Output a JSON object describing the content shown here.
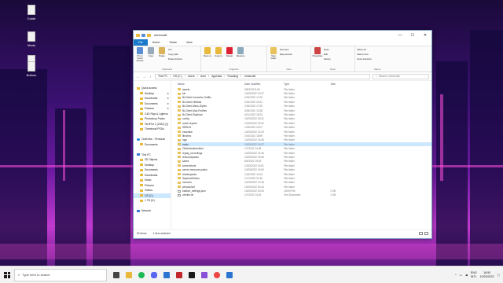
{
  "desktop": {
    "icons": [
      {
        "label": "Guide"
      },
      {
        "label": "Mods"
      },
      {
        "label": "Docs"
      },
      {
        "label": "Bottom"
      }
    ]
  },
  "window": {
    "title": "minecraft",
    "controls": {
      "minimize": "—",
      "maximize": "☐",
      "close": "✕"
    },
    "ribbon_tabs": [
      "File",
      "Home",
      "Share",
      "View"
    ],
    "ribbon": {
      "clipboard": {
        "label": "Clipboard",
        "pin": "Pin to Quick access",
        "copy": "Copy",
        "paste": "Paste",
        "cut": "Cut",
        "copy_path": "Copy path",
        "paste_shortcut": "Paste shortcut"
      },
      "organize": {
        "label": "Organize",
        "move_to": "Move to",
        "copy_to": "Copy to",
        "delete": "Delete",
        "rename": "Rename"
      },
      "new": {
        "label": "New",
        "new_folder": "New folder",
        "new_item": "New item",
        "easy_access": "Easy access"
      },
      "open": {
        "label": "Open",
        "properties": "Properties",
        "open": "Open",
        "edit": "Edit",
        "history": "History"
      },
      "select": {
        "label": "Select",
        "select_all": "Select all",
        "select_none": "Select none",
        "invert": "Invert selection"
      }
    },
    "address": {
      "back": "←",
      "forward": "→",
      "up": "↑",
      "path": [
        "This PC",
        "OS (C:)",
        "Users",
        "User",
        "AppData",
        "Roaming",
        ".minecraft"
      ],
      "search_placeholder": "Search .minecraft"
    },
    "nav": [
      {
        "label": "Quick access",
        "level": 0
      },
      {
        "label": "Desktop",
        "level": 1,
        "pin": "✱"
      },
      {
        "label": "Downloads",
        "level": 1,
        "pin": "✱"
      },
      {
        "label": "Documents",
        "level": 1,
        "pin": "✱"
      },
      {
        "label": "Pictures",
        "level": 1,
        "pin": "✱"
      },
      {
        "label": "C4D Rigs & Lightroo",
        "level": 1
      },
      {
        "label": "Photoshop Packs",
        "level": 1
      },
      {
        "label": "TeroFire 2 (2022) [1]",
        "level": 1
      },
      {
        "label": "Thumbnail PSDs",
        "level": 1
      },
      {
        "label": "",
        "level": 1
      },
      {
        "label": "OneDrive - Personal",
        "level": 0
      },
      {
        "label": "Documents",
        "level": 1
      },
      {
        "label": "",
        "level": 1
      },
      {
        "label": "This PC",
        "level": 0
      },
      {
        "label": "3D Objects",
        "level": 1
      },
      {
        "label": "Desktop",
        "level": 1
      },
      {
        "label": "Documents",
        "level": 1
      },
      {
        "label": "Downloads",
        "level": 1
      },
      {
        "label": "Music",
        "level": 1
      },
      {
        "label": "Pictures",
        "level": 1
      },
      {
        "label": "Videos",
        "level": 1
      },
      {
        "label": "OS (C:)",
        "level": 1
      },
      {
        "label": "1 TB (D:)",
        "level": 1
      },
      {
        "label": "",
        "level": 1
      },
      {
        "label": "Network",
        "level": 0
      }
    ],
    "columns": {
      "name": "Name",
      "date": "Date modified",
      "type": "Type",
      "size": "Size"
    },
    "files": [
      {
        "name": "assets",
        "date": "3/8/2022 8:06",
        "type": "File folder",
        "size": ""
      },
      {
        "name": "bin",
        "date": "10/25/2022 19:37",
        "type": "File folder",
        "size": ""
      },
      {
        "name": "BLClient-Cosmetic-Outfits",
        "date": "2/15/2022 17:00",
        "type": "File folder",
        "size": ""
      },
      {
        "name": "BLClient-HitStats",
        "date": "2/15/2022 20:21",
        "type": "File folder",
        "size": ""
      },
      {
        "name": "BLClient-Menu-Styles",
        "date": "2/15/2022 17:00",
        "type": "File folder",
        "size": ""
      },
      {
        "name": "BLClient-Mod-Profiles",
        "date": "3/18/2022 13:28",
        "type": "File folder",
        "size": ""
      },
      {
        "name": "BLClient-Skyblock",
        "date": "4/21/2022 18:22",
        "type": "File folder",
        "size": ""
      },
      {
        "name": "config",
        "date": "10/25/2022 18:31",
        "type": "File folder",
        "size": ""
      },
      {
        "name": "crash-reports",
        "date": "10/18/2022 15:00",
        "type": "File folder",
        "size": ""
      },
      {
        "name": "DEBUG",
        "date": "1/18/2022 20:07",
        "type": "File folder",
        "size": ""
      },
      {
        "name": "essential",
        "date": "10/25/2022 21:20",
        "type": "File folder",
        "size": ""
      },
      {
        "name": "libraries",
        "date": "2/15/2022 16:59",
        "type": "File folder",
        "size": ""
      },
      {
        "name": "logs",
        "date": "10/25/2022 15:46",
        "type": "File folder",
        "size": ""
      },
      {
        "name": "mods",
        "date": "10/25/2022 19:37",
        "type": "File folder",
        "size": ""
      },
      {
        "name": "OldAnimationsMod",
        "date": "1/7/2022 14:28",
        "type": "File folder",
        "size": ""
      },
      {
        "name": "replay_recordings",
        "date": "10/25/2022 15:45",
        "type": "File folder",
        "size": ""
      },
      {
        "name": "resourcepacks",
        "date": "10/25/2022 15:56",
        "type": "File folder",
        "size": ""
      },
      {
        "name": "saves",
        "date": "8/4/2022 15:19",
        "type": "File folder",
        "size": ""
      },
      {
        "name": "screenshots",
        "date": "10/25/2022 15:51",
        "type": "File folder",
        "size": ""
      },
      {
        "name": "server-resource-packs",
        "date": "10/25/2022 15:50",
        "type": "File folder",
        "size": ""
      },
      {
        "name": "shaderpacks",
        "date": "1/15/2022 15:23",
        "type": "File folder",
        "size": ""
      },
      {
        "name": "SkyblockExtras",
        "date": "1/17/2022 21:45",
        "type": "File folder",
        "size": ""
      },
      {
        "name": "versions",
        "date": "10/25/2022 12:48",
        "type": "File folder",
        "size": ""
      },
      {
        "name": "webcache2",
        "date": "10/25/2022 15:44",
        "type": "File folder",
        "size": ""
      },
      {
        "name": "badlion_settings.json",
        "date": "10/25/2022 20:26",
        "type": "JSON File",
        "size": "1 KB"
      },
      {
        "name": "clientid.txt",
        "date": "1/7/2022 14:15",
        "type": "Text Document",
        "size": "1 KB"
      }
    ],
    "selected_file": "mods",
    "status": {
      "count": "52 items",
      "selected": "1 item selected"
    }
  },
  "taskbar": {
    "search_placeholder": "Type here to search",
    "tray": {
      "lang_top": "ENG",
      "lang_bottom": "INTL",
      "time": "18:50",
      "date": "10/25/2022"
    }
  },
  "colors": {
    "accent": "#1979ca",
    "selection": "#cce8ff",
    "folder": "#e8c25a"
  }
}
